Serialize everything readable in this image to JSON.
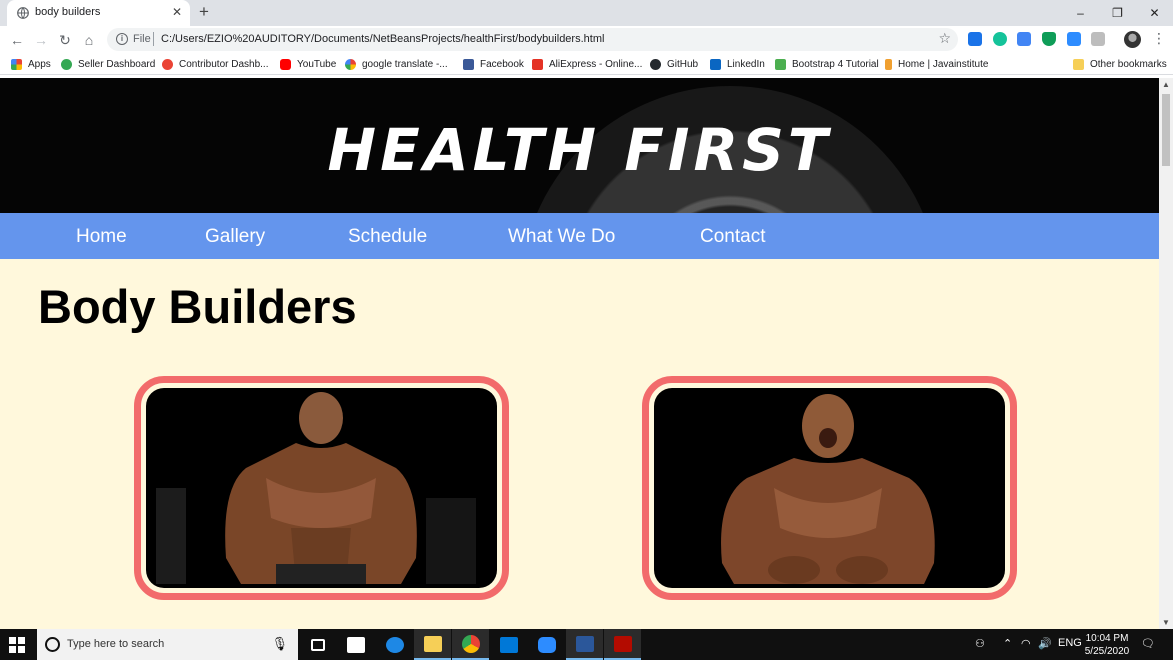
{
  "browser": {
    "tab_title": "body builders",
    "new_tab_symbol": "+",
    "address_scheme": "File",
    "address_url": "C:/Users/EZIO%20AUDITORY/Documents/NetBeansProjects/healthFirst/bodybuilders.html",
    "window_controls": [
      "–",
      "❐",
      "✕"
    ],
    "bookmarks": [
      {
        "label": "Apps",
        "icon": "apps-grid-icon",
        "color": "#ea4335"
      },
      {
        "label": "Seller Dashboard",
        "icon": "seller-dashboard-icon",
        "color": "#34a853"
      },
      {
        "label": "Contributor Dashb...",
        "icon": "contributor-icon",
        "color": "#ea4335"
      },
      {
        "label": "YouTube",
        "icon": "youtube-icon",
        "color": "#ff0000"
      },
      {
        "label": "google translate -...",
        "icon": "google-icon",
        "color": "#4285f4"
      },
      {
        "label": "Facebook",
        "icon": "facebook-icon",
        "color": "#3b5998"
      },
      {
        "label": "AliExpress - Online...",
        "icon": "aliexpress-icon",
        "color": "#e43225"
      },
      {
        "label": "GitHub",
        "icon": "github-icon",
        "color": "#24292e"
      },
      {
        "label": "LinkedIn",
        "icon": "linkedin-icon",
        "color": "#0a66c2"
      },
      {
        "label": "Bootstrap 4 Tutorial",
        "icon": "w3schools-icon",
        "color": "#4caf50"
      },
      {
        "label": "Home | Javainstitute",
        "icon": "javainstitute-icon",
        "color": "#f0a030"
      },
      {
        "label": "Other bookmarks",
        "icon": "folder-icon",
        "color": "#f6cf57"
      }
    ]
  },
  "page": {
    "brand": "HEALTH FIRST",
    "nav": [
      "Home",
      "Gallery",
      "Schedule",
      "What We Do",
      "Contact"
    ],
    "heading": "Body Builders",
    "colors": {
      "nav_bg": "#6495ed",
      "page_bg": "#fff8dc",
      "frame_border": "#f26b6b"
    }
  },
  "taskbar": {
    "search_placeholder": "Type here to search",
    "language": "ENG",
    "time": "10:04 PM",
    "date": "5/25/2020"
  }
}
